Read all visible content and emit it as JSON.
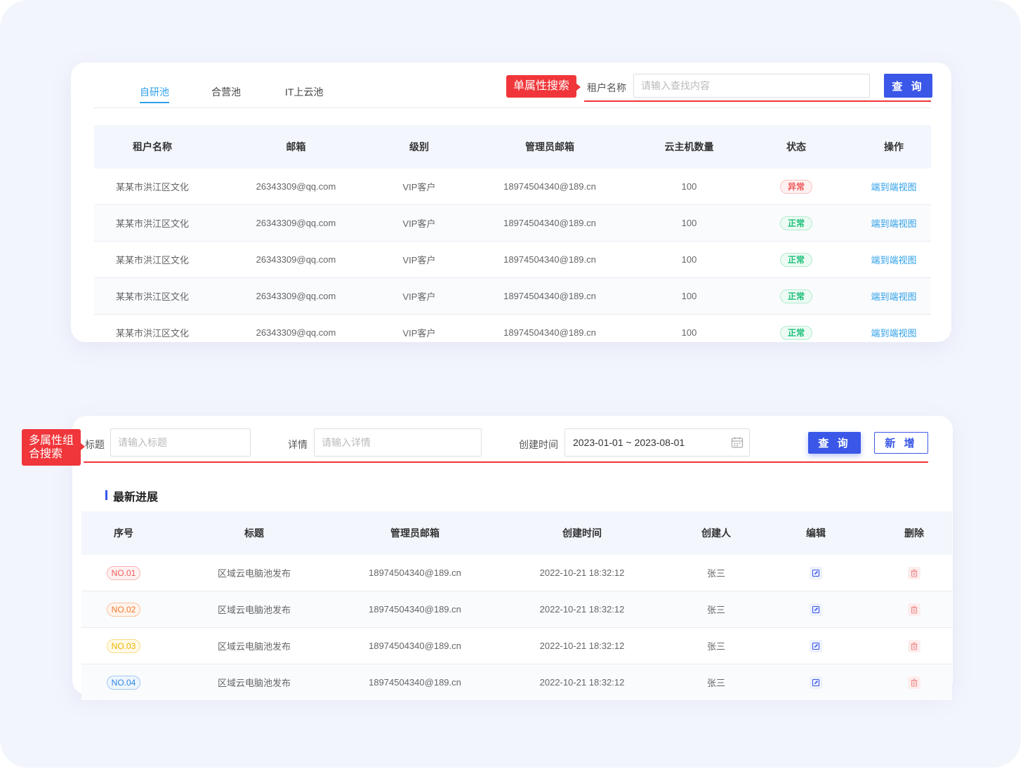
{
  "tenant_panel": {
    "tabs": [
      {
        "label": "自研池",
        "active": true
      },
      {
        "label": "合营池",
        "active": false
      },
      {
        "label": "IT上云池",
        "active": false
      }
    ],
    "annotation": "单属性搜索",
    "search_label": "租户名称",
    "search_placeholder": "请输入查找内容",
    "query_button": "查 询",
    "columns": [
      "租户名称",
      "邮箱",
      "级别",
      "管理员邮箱",
      "云主机数量",
      "状态",
      "操作"
    ],
    "rows": [
      {
        "tenant": "某某市洪江区文化",
        "email": "26343309@qq.com",
        "level": "VIP客户",
        "admin_email": "18974504340@189.cn",
        "vm_count": "100",
        "status": "异常",
        "status_type": "err",
        "action": "端到端视图"
      },
      {
        "tenant": "某某市洪江区文化",
        "email": "26343309@qq.com",
        "level": "VIP客户",
        "admin_email": "18974504340@189.cn",
        "vm_count": "100",
        "status": "正常",
        "status_type": "ok",
        "action": "端到端视图"
      },
      {
        "tenant": "某某市洪江区文化",
        "email": "26343309@qq.com",
        "level": "VIP客户",
        "admin_email": "18974504340@189.cn",
        "vm_count": "100",
        "status": "正常",
        "status_type": "ok",
        "action": "端到端视图"
      },
      {
        "tenant": "某某市洪江区文化",
        "email": "26343309@qq.com",
        "level": "VIP客户",
        "admin_email": "18974504340@189.cn",
        "vm_count": "100",
        "status": "正常",
        "status_type": "ok",
        "action": "端到端视图"
      },
      {
        "tenant": "某某市洪江区文化",
        "email": "26343309@qq.com",
        "level": "VIP客户",
        "admin_email": "18974504340@189.cn",
        "vm_count": "100",
        "status": "正常",
        "status_type": "ok",
        "action": "端到端视图"
      }
    ]
  },
  "progress_panel": {
    "annotation": "多属性组合搜索",
    "title_label": "标题",
    "title_placeholder": "请输入标题",
    "detail_label": "详情",
    "detail_placeholder": "请输入详情",
    "date_label": "创建时间",
    "date_range": "2023-01-01 ~ 2023-08-01",
    "query_button": "查 询",
    "add_button": "新 增",
    "section_title": "最新进展",
    "columns": [
      "序号",
      "标题",
      "管理员邮箱",
      "创建时间",
      "创建人",
      "编辑",
      "删除"
    ],
    "rows": [
      {
        "no": "NO.01",
        "color": "#f05a5a",
        "bg": "#fff1f1",
        "title": "区域云电脑池发布",
        "admin_email": "18974504340@189.cn",
        "created": "2022-10-21 18:32:12",
        "creator": "张三"
      },
      {
        "no": "NO.02",
        "color": "#f07a2c",
        "bg": "#fff4ec",
        "title": "区域云电脑池发布",
        "admin_email": "18974504340@189.cn",
        "created": "2022-10-21 18:32:12",
        "creator": "张三"
      },
      {
        "no": "NO.03",
        "color": "#f0b400",
        "bg": "#fff9e6",
        "title": "区域云电脑池发布",
        "admin_email": "18974504340@189.cn",
        "created": "2022-10-21 18:32:12",
        "creator": "张三"
      },
      {
        "no": "NO.04",
        "color": "#2f86e0",
        "bg": "#eef5fd",
        "title": "区域云电脑池发布",
        "admin_email": "18974504340@189.cn",
        "created": "2022-10-21 18:32:12",
        "creator": "张三"
      }
    ]
  },
  "colors": {
    "accent_blue": "#3a57e8",
    "tab_active": "#2fa0e8",
    "annotation_red": "#f0363a",
    "page_bg": "#f3f5fd"
  }
}
